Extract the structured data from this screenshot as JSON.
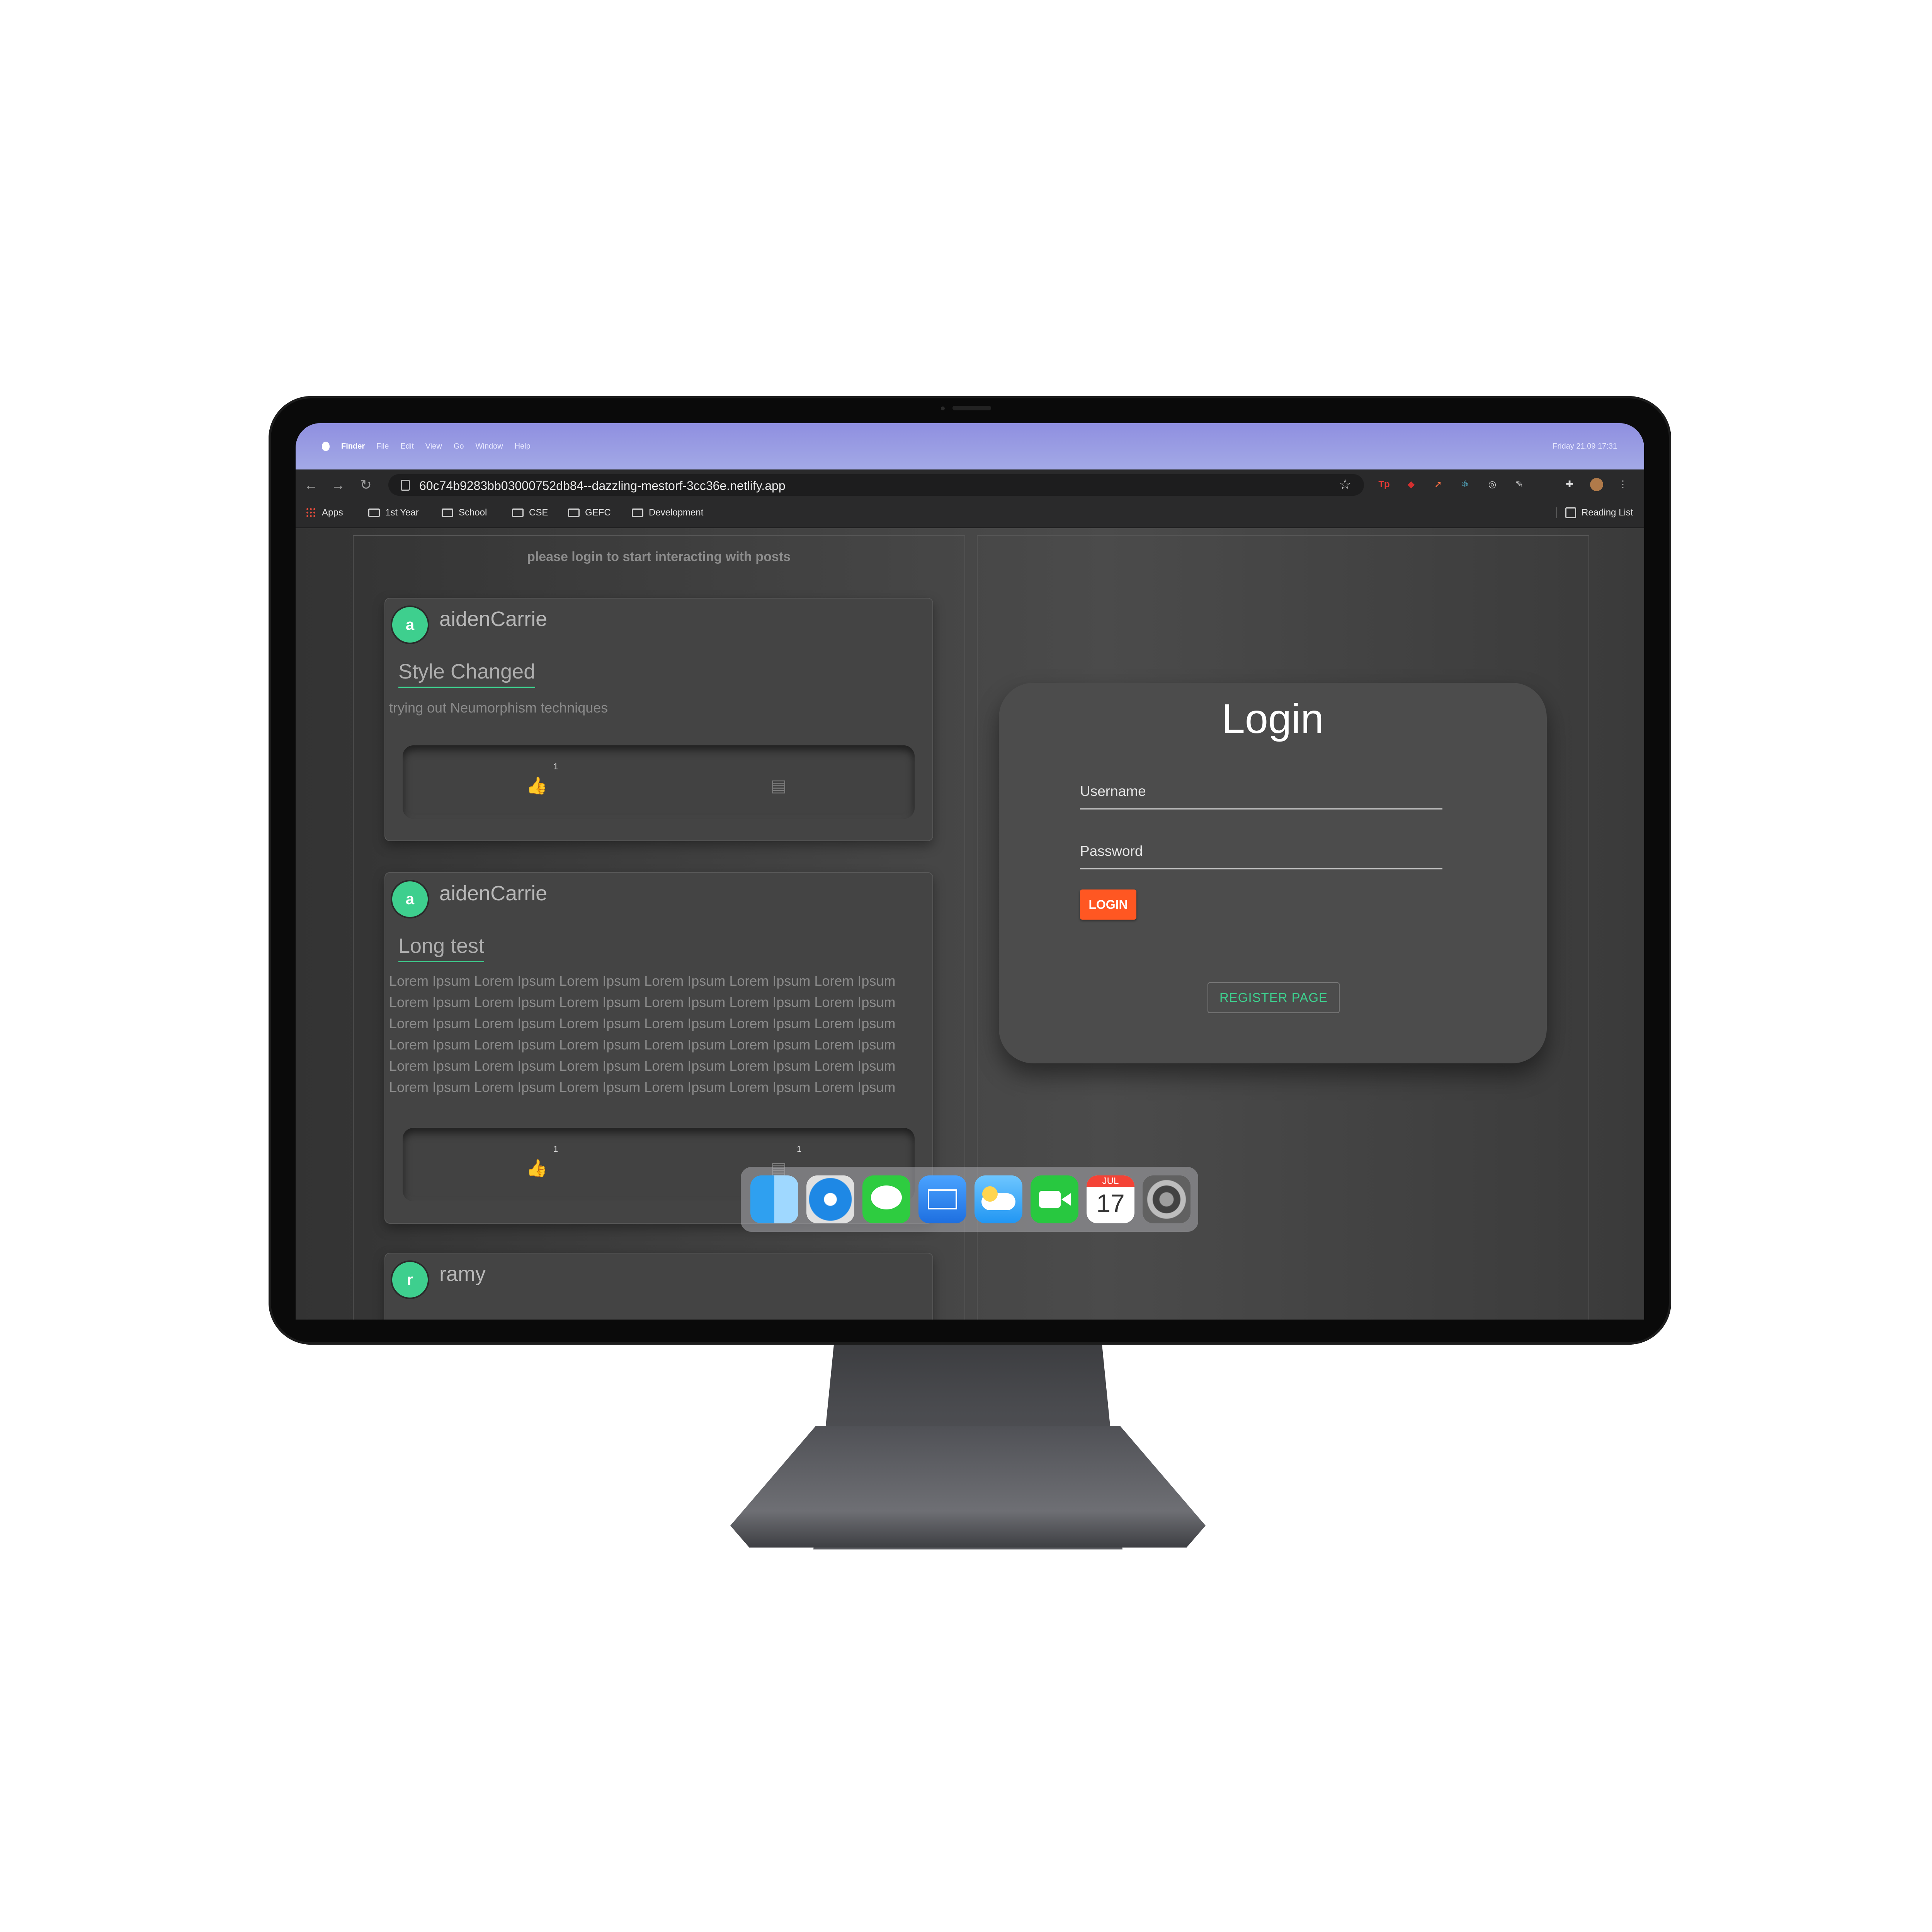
{
  "menubar": {
    "items": [
      "Finder",
      "File",
      "Edit",
      "View",
      "Go",
      "Window",
      "Help"
    ],
    "clock": "Friday 21.09 17:31"
  },
  "browser": {
    "url": "60c74b9283bb03000752db84--dazzling-mestorf-3cc36e.netlify.app",
    "bookmarks": [
      "Apps",
      "1st Year",
      "School",
      "CSE",
      "GEFC",
      "Development"
    ],
    "reading_list": "Reading List",
    "extensions": [
      "tp-extension-icon",
      "red-extension-icon",
      "rocket-extension-icon",
      "react-extension-icon",
      "target-extension-icon",
      "pen-extension-icon",
      "puzzle-icon",
      "profile-avatar",
      "more-menu-icon"
    ]
  },
  "feed": {
    "notice": "please login to start interacting with posts",
    "posts": [
      {
        "username": "aidenCarrie",
        "avatar": "a",
        "title": "Style Changed",
        "body": "trying out Neumorphism techniques",
        "likes": "1",
        "comments": ""
      },
      {
        "username": "aidenCarrie",
        "avatar": "a",
        "title": "Long test",
        "body": "Lorem Ipsum Lorem Ipsum Lorem Ipsum Lorem Ipsum Lorem Ipsum Lorem Ipsum Lorem Ipsum Lorem Ipsum Lorem Ipsum Lorem Ipsum Lorem Ipsum Lorem Ipsum Lorem Ipsum Lorem Ipsum Lorem Ipsum Lorem Ipsum Lorem Ipsum Lorem Ipsum Lorem Ipsum Lorem Ipsum Lorem Ipsum Lorem Ipsum Lorem Ipsum Lorem Ipsum Lorem Ipsum Lorem Ipsum Lorem Ipsum Lorem Ipsum Lorem Ipsum Lorem Ipsum Lorem Ipsum Lorem Ipsum Lorem Ipsum Lorem Ipsum Lorem Ipsum Lorem Ipsum",
        "likes": "1",
        "comments": "1"
      },
      {
        "username": "ramy",
        "avatar": "r"
      }
    ]
  },
  "login": {
    "title": "Login",
    "username_label": "Username",
    "password_label": "Password",
    "login_button": "LOGIN",
    "register_button": "REGISTER PAGE"
  },
  "dock": {
    "apps": [
      "finder-icon",
      "safari-icon",
      "messages-icon",
      "mail-icon",
      "icloud-icon",
      "facetime-icon",
      "calendar-icon",
      "system-preferences-icon"
    ],
    "calendar_month": "JUL",
    "calendar_day": "17"
  },
  "colors": {
    "accent_green": "#3ecf8e",
    "login_orange": "#ff5722",
    "menubar_purple": "#9ea3e4"
  }
}
